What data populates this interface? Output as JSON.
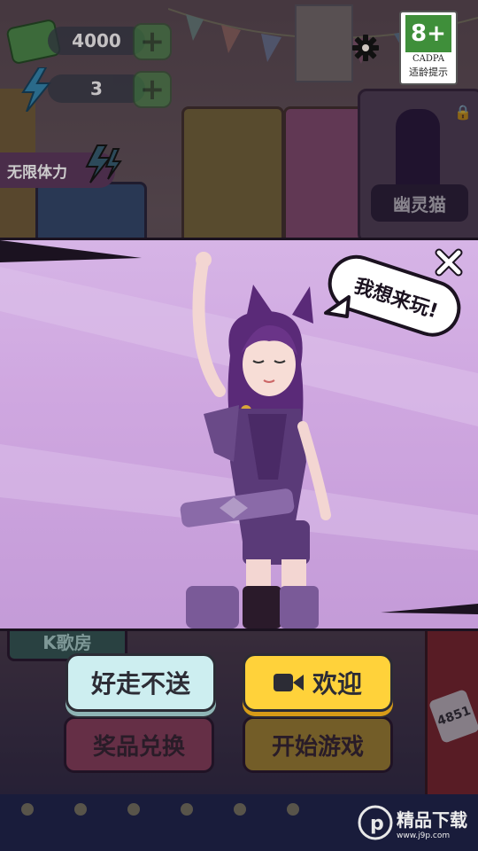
{
  "hud": {
    "coins": "4000",
    "energy": "3",
    "unlimited_energy_label": "无限体力",
    "age_rating": "8+",
    "age_org": "CADPA",
    "age_note": "适龄提示"
  },
  "background": {
    "locked_character_label": "幽灵猫",
    "karaoke_label": "K歌房",
    "machine_counter": "4851",
    "prize_exchange_label": "奖品兑换",
    "start_game_label": "开始游戏"
  },
  "popup": {
    "speech": "我想来玩!",
    "refuse_label": "好走不送",
    "welcome_label": "欢迎"
  },
  "watermark": {
    "brand": "精品下载",
    "url": "www.j9p.com"
  },
  "colors": {
    "panel": "#cfa7e0",
    "welcome_button": "#ffd23a",
    "refuse_button": "#cdeef0",
    "outfit_purple": "#5a3a78"
  }
}
